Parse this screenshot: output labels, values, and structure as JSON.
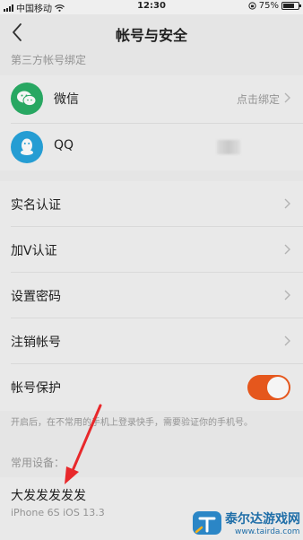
{
  "status_bar": {
    "carrier": "中国移动",
    "time": "12:30",
    "battery": "75%",
    "battery_level": 0.75
  },
  "nav": {
    "title": "帐号与安全"
  },
  "third_party": {
    "section_label": "第三方帐号绑定",
    "items": [
      {
        "name": "微信",
        "value": "点击绑定",
        "icon": "wechat-icon"
      },
      {
        "name": "QQ",
        "value": "",
        "icon": "qq-icon"
      }
    ]
  },
  "settings": {
    "items": [
      {
        "label": "实名认证"
      },
      {
        "label": "加V认证"
      },
      {
        "label": "设置密码"
      },
      {
        "label": "注销帐号"
      },
      {
        "label": "帐号保护"
      }
    ],
    "protection_toggle": true,
    "hint": "开启后，在不常用的手机上登录快手，需要验证你的手机号。"
  },
  "devices": {
    "section_label": "常用设备：",
    "items": [
      {
        "name": "大发发发发发",
        "model": "iPhone 6S iOS 13.3"
      }
    ]
  },
  "watermark": {
    "brand": "泰尔达游戏网",
    "site": "www.tairda.com"
  },
  "colors": {
    "toggle_on": "#ef5b1f",
    "wechat": "#2aae67",
    "qq": "#27a4dc",
    "annotation_arrow": "#e8282b"
  }
}
